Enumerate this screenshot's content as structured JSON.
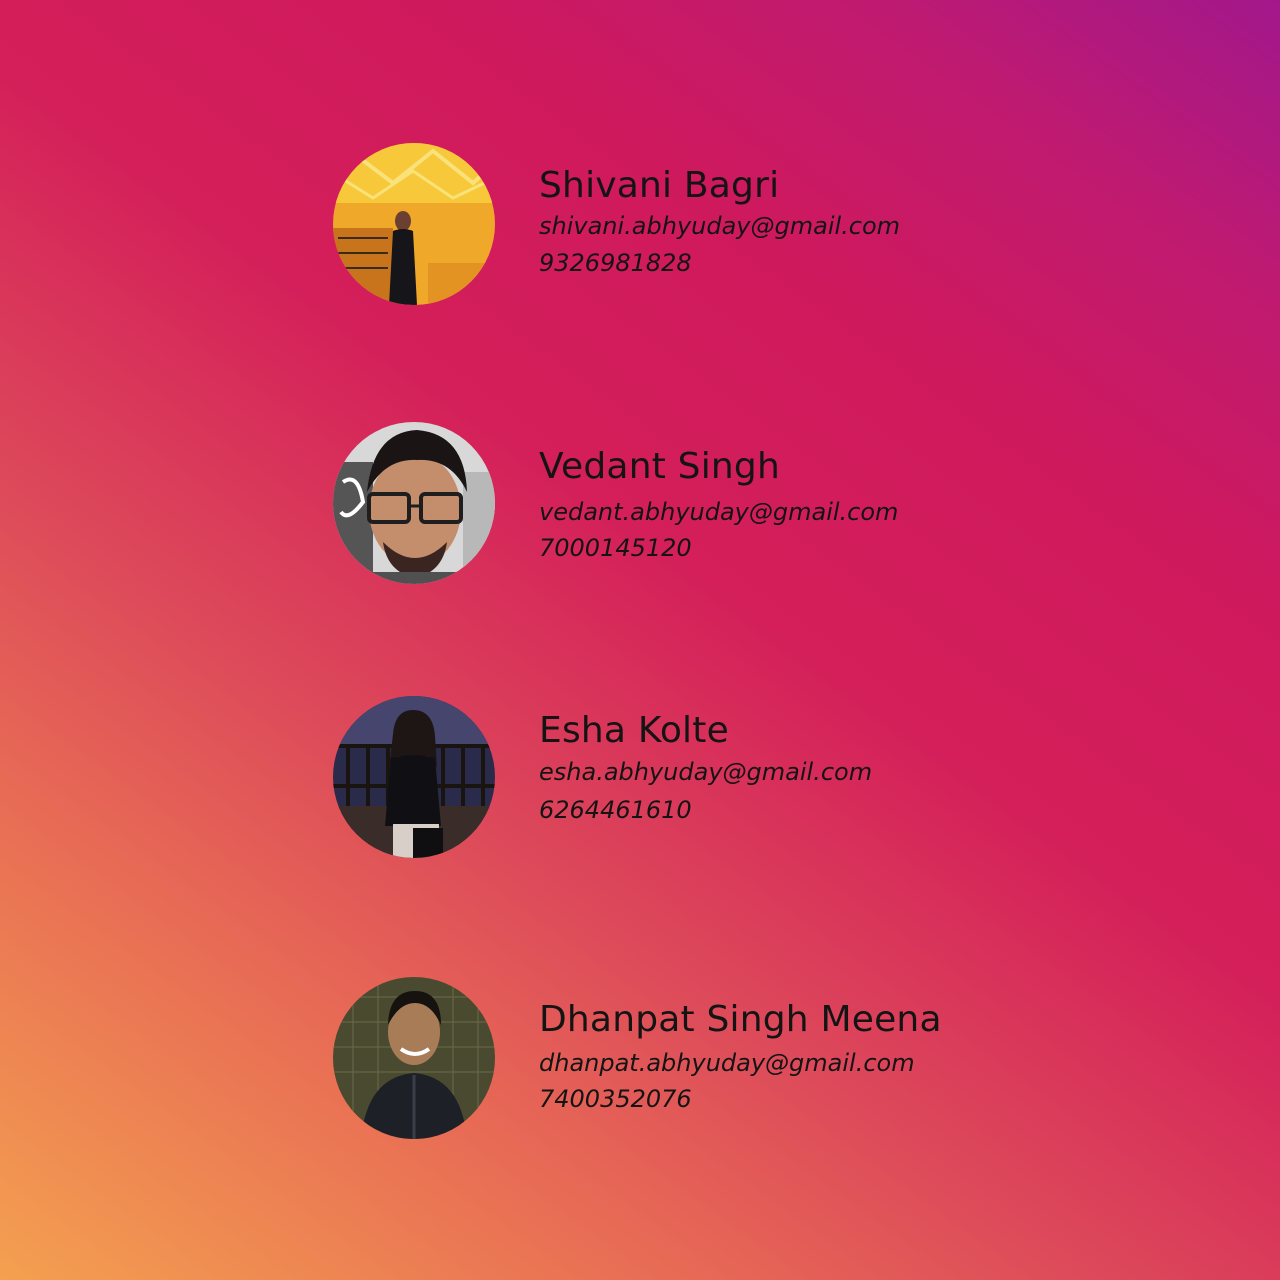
{
  "contacts": [
    {
      "name": "Shivani Bagri",
      "email": "shivani.abhyuday@gmail.com",
      "phone": "9326981828"
    },
    {
      "name": "Vedant Singh",
      "email": "vedant.abhyuday@gmail.com",
      "phone": "7000145120"
    },
    {
      "name": "Esha Kolte",
      "email": "esha.abhyuday@gmail.com",
      "phone": "6264461610"
    },
    {
      "name": "Dhanpat Singh Meena",
      "email": "dhanpat.abhyuday@gmail.com",
      "phone": "7400352076"
    }
  ],
  "colors": {
    "gradient_start": "#f4a050",
    "gradient_mid": "#d41f5a",
    "gradient_end": "#a2188b",
    "text": "#141414"
  }
}
